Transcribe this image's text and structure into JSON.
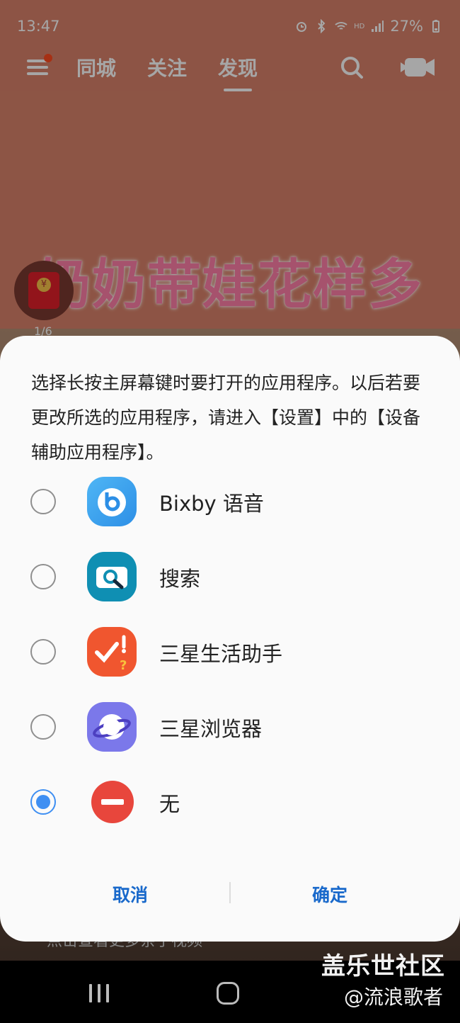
{
  "status_bar": {
    "time": "13:47",
    "battery": "27%",
    "signal_label": "HD"
  },
  "background_app": {
    "tabs": [
      {
        "label": "同城"
      },
      {
        "label": "关注"
      },
      {
        "label": "发现"
      }
    ],
    "active_tab": "发现",
    "caption": "奶奶带娃花样多",
    "image_counter": "1/6",
    "bottom_hint": "点击查看更多亲子视频"
  },
  "dialog": {
    "message": "选择长按主屏幕键时要打开的应用程序。以后若要更改所选的应用程序，请进入【设置】中的【设备辅助应用程序】。",
    "options": [
      {
        "label": "Bixby 语音",
        "icon": "bixby-icon",
        "checked": false,
        "color": "#3aa9ee"
      },
      {
        "label": "搜索",
        "icon": "search-app-icon",
        "checked": false,
        "color": "#0f8fb3"
      },
      {
        "label": "三星生活助手",
        "icon": "samsung-life-assistant-icon",
        "checked": false,
        "color": "#f0562f"
      },
      {
        "label": "三星浏览器",
        "icon": "samsung-browser-icon",
        "checked": false,
        "color": "#6d6de8"
      },
      {
        "label": "无",
        "icon": "none-icon",
        "checked": true,
        "color": "#e8463c"
      }
    ],
    "cancel_label": "取消",
    "confirm_label": "确定",
    "accent_color": "#1969cb",
    "radio_selected_color": "#3f8ff2"
  },
  "watermark": {
    "line1": "盖乐世社区",
    "line2": "@流浪歌者"
  }
}
